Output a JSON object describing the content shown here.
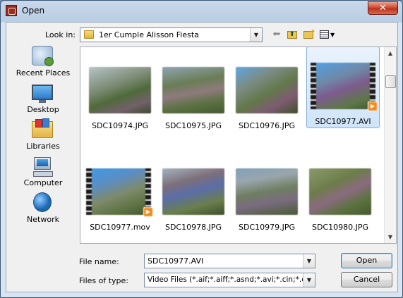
{
  "window": {
    "title": "Open",
    "close_glyph": "✕"
  },
  "toolbar": {
    "look_in_label": "Look in:",
    "look_in_value": "1er Cumple Alisson Fiesta",
    "icons": [
      "back-arrow-icon",
      "up-one-level-icon",
      "new-folder-icon",
      "view-menu-icon"
    ]
  },
  "places": [
    {
      "label": "Recent Places",
      "icon": "recent-places-icon"
    },
    {
      "label": "Desktop",
      "icon": "desktop-icon"
    },
    {
      "label": "Libraries",
      "icon": "libraries-icon"
    },
    {
      "label": "Computer",
      "icon": "computer-icon"
    },
    {
      "label": "Network",
      "icon": "network-icon"
    }
  ],
  "files": [
    {
      "name": "SDC10974.JPG",
      "type": "image"
    },
    {
      "name": "SDC10975.JPG",
      "type": "image"
    },
    {
      "name": "SDC10976.JPG",
      "type": "image"
    },
    {
      "name": "SDC10977.AVI",
      "type": "video",
      "selected": true
    },
    {
      "name": "SDC10977.mov",
      "type": "video"
    },
    {
      "name": "SDC10978.JPG",
      "type": "image"
    },
    {
      "name": "SDC10979.JPG",
      "type": "image"
    },
    {
      "name": "SDC10980.JPG",
      "type": "image"
    }
  ],
  "form": {
    "file_name_label": "File name:",
    "file_name_value": "SDC10977.AVI",
    "files_of_type_label": "Files of type:",
    "files_of_type_value": "Video Files (*.aif;*.aiff;*.asnd;*.avi;*.cin;*.dpx;*.m"
  },
  "buttons": {
    "open": "Open",
    "cancel": "Cancel"
  },
  "colors": {
    "selection_fill": "#cfe4fa",
    "selection_border": "#84acdd",
    "close_button": "#c9432c"
  }
}
